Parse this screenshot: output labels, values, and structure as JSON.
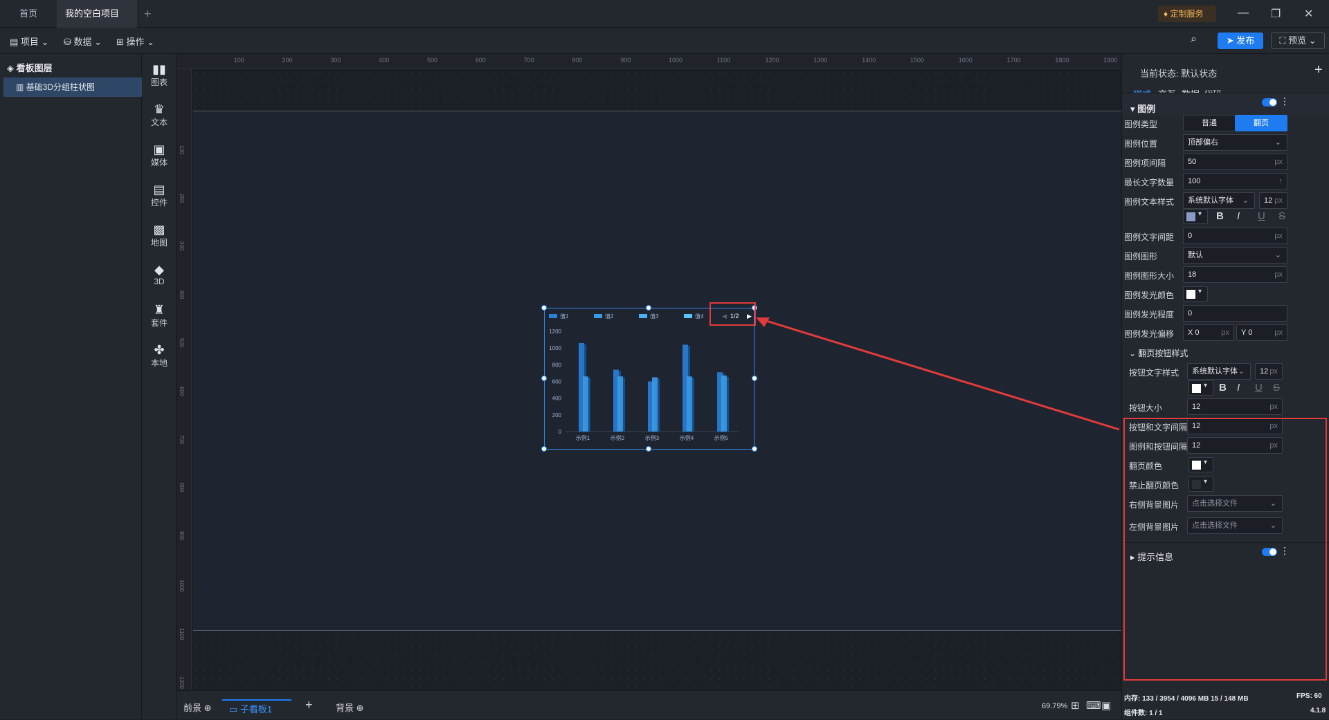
{
  "tabs": [
    {
      "label": "首页"
    },
    {
      "label": "我的空白项目"
    }
  ],
  "titlebar": {
    "custom_service": "定制服务"
  },
  "toolbar": {
    "project": "项目",
    "data": "数据",
    "operate": "操作",
    "publish": "发布",
    "preview": "预览"
  },
  "left_panel": {
    "title": "看板图层",
    "layer_item": "基础3D分组柱状图"
  },
  "categories": [
    "图表",
    "文本",
    "媒体",
    "控件",
    "地图",
    "3D",
    "套件",
    "本地"
  ],
  "ruler_top": [
    "100",
    "200",
    "300",
    "400",
    "500",
    "600",
    "700",
    "800",
    "900",
    "1000",
    "1100",
    "1200",
    "1300",
    "1400",
    "1500",
    "1600",
    "1700",
    "1800",
    "1900"
  ],
  "ruler_left": [
    "100",
    "200",
    "300",
    "400",
    "500",
    "600",
    "700",
    "800",
    "900",
    "1000",
    "1100",
    "1200"
  ],
  "chart_data": {
    "type": "bar",
    "categories": [
      "示例1",
      "示例2",
      "示例3",
      "示例4",
      "示例5"
    ],
    "series": [
      {
        "name": "值1",
        "values": [
          1060,
          740,
          600,
          1040,
          710
        ],
        "color": "#2a7fd8"
      },
      {
        "name": "值2",
        "values": [
          660,
          660,
          650,
          660,
          670
        ],
        "color": "#3a9ce8"
      }
    ],
    "legend": [
      "值1",
      "值2",
      "值3",
      "值4"
    ],
    "yticks": [
      "1200",
      "1000",
      "800",
      "600",
      "400",
      "200",
      "0"
    ],
    "ylim": [
      0,
      1200
    ],
    "pager": "1/2"
  },
  "bottom": {
    "foreground": "前景",
    "subboard": "子看板1",
    "background": "背景",
    "zoom": "69.79%"
  },
  "right_panel": {
    "state_label": "当前状态:",
    "state_value": "默认状态",
    "tabs": [
      "样式",
      "交互",
      "数据",
      "代码"
    ],
    "section_legend": "图例",
    "legend_type_label": "图例类型",
    "legend_type_opt1": "普通",
    "legend_type_opt2": "翻页",
    "legend_pos_label": "图例位置",
    "legend_pos_value": "顶部偏右",
    "legend_gap_label": "图例项间隔",
    "legend_gap_value": "50",
    "max_text_label": "最长文字数量",
    "max_text_value": "100",
    "text_style_label": "图例文本样式",
    "font_value": "系统默认字体",
    "font_size": "12",
    "text_spacing_label": "图例文字间距",
    "text_spacing_value": "0",
    "shape_label": "图例图形",
    "shape_value": "默认",
    "shape_size_label": "图例图形大小",
    "shape_size_value": "18",
    "glow_color_label": "图例发光颜色",
    "glow_level_label": "图例发光程度",
    "glow_level_value": "0",
    "glow_offset_label": "图例发光偏移",
    "glow_x": "0",
    "glow_y": "0",
    "section_pager": "翻页按钮样式",
    "btn_text_style_label": "按钮文字样式",
    "btn_font": "系统默认字体",
    "btn_font_size": "12",
    "btn_size_label": "按钮大小",
    "btn_size_value": "12",
    "btn_text_gap_label": "按钮和文字间隔",
    "btn_text_gap_value": "12",
    "legend_btn_gap_label": "图例和按钮间隔",
    "legend_btn_gap_value": "12",
    "page_color_label": "翻页颜色",
    "disabled_color_label": "禁止翻页颜色",
    "right_bg_label": "右侧背景图片",
    "right_bg_value": "点击选择文件",
    "left_bg_label": "左侧背景图片",
    "left_bg_value": "点击选择文件",
    "section_tooltip": "提示信息",
    "unit": "px"
  },
  "status": {
    "memory": "内存: 133 / 3954 / 4096 MB 15 / 148 MB",
    "fps": "FPS: 60",
    "components": "组件数: 1 / 1",
    "version": "4.1.8"
  }
}
